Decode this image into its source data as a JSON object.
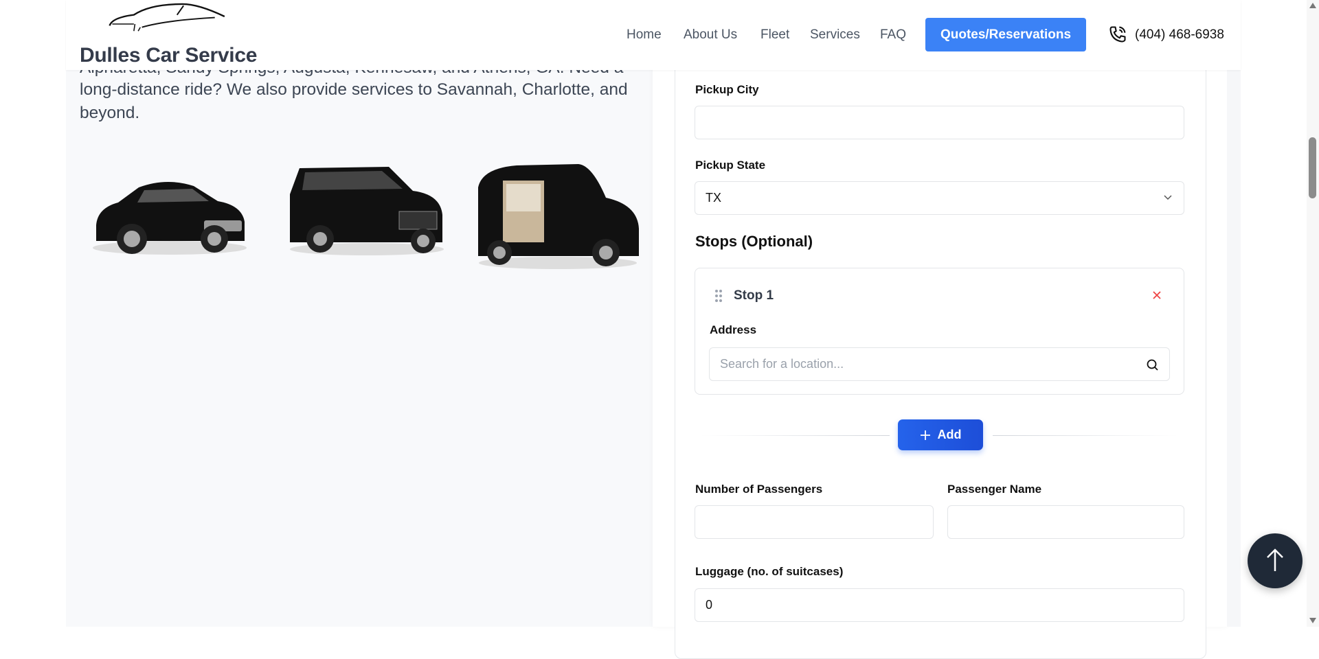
{
  "header": {
    "brand": "Dulles Car Service",
    "nav": [
      "Home",
      "About Us",
      "Fleet",
      "Services",
      "FAQ"
    ],
    "cta": "Quotes/Reservations",
    "phone": "(404) 468-6938"
  },
  "intro": {
    "line1": "Alpharetta, Sandy Springs, Augusta, Kennesaw, and Athens, GA. Need a",
    "line2": "long-distance ride? We also provide services to Savannah, Charlotte, and",
    "line3": "beyond."
  },
  "form": {
    "pickup_city_label": "Pickup City",
    "pickup_city_value": "",
    "pickup_state_label": "Pickup State",
    "pickup_state_value": "TX",
    "stops_heading": "Stops (Optional)",
    "stop_title": "Stop 1",
    "address_label": "Address",
    "address_placeholder": "Search for a location...",
    "add_label": "Add",
    "passengers_label": "Number of Passengers",
    "passengers_value": "",
    "passenger_name_label": "Passenger Name",
    "passenger_name_value": "",
    "luggage_label": "Luggage (no. of suitcases)",
    "luggage_value": "0"
  },
  "colors": {
    "accent": "#3b82f6",
    "add_button": "#2563eb",
    "remove": "#ef4444",
    "scroll_top": "#1f2937"
  }
}
